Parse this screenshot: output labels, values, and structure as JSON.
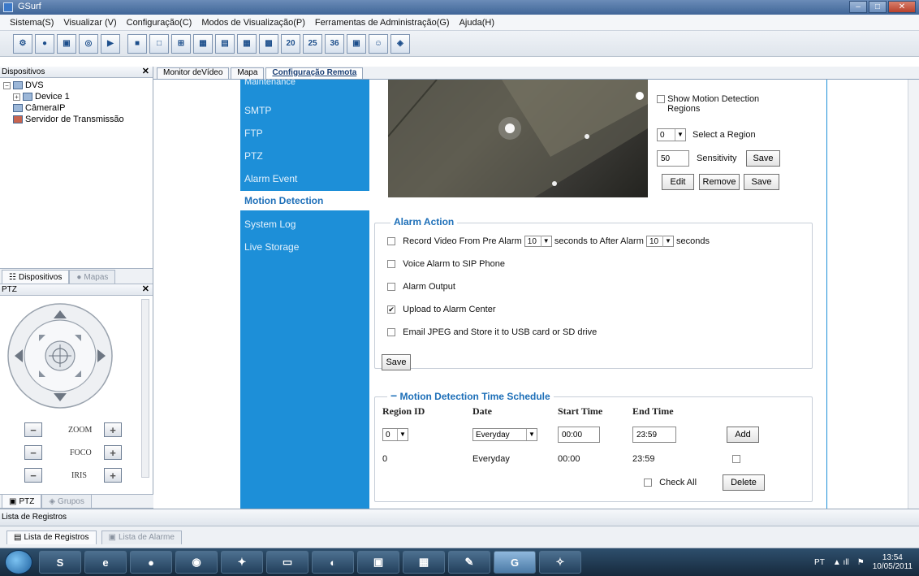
{
  "window": {
    "title": "GSurf"
  },
  "menu": [
    "Sistema(S)",
    "Visualizar (V)",
    "Configuração(C)",
    "Modos de Visualização(P)",
    "Ferramentas de Administração(G)",
    "Ajuda(H)"
  ],
  "toolbar": {
    "grid_labels": [
      "20",
      "25",
      "36"
    ]
  },
  "devices": {
    "header": "Dispositivos",
    "tree": [
      "DVS",
      "Device 1",
      "CâmeraIP",
      "Servidor de Transmissão"
    ],
    "tabs": [
      "Dispositivos",
      "Mapas"
    ]
  },
  "ptz": {
    "header": "PTZ",
    "zoom": "ZOOM",
    "focus": "FOCO",
    "iris": "IRIS",
    "minus": "−",
    "plus": "+",
    "tabs": [
      "PTZ",
      "Grupos"
    ]
  },
  "main_tabs": [
    "Monitor deVídeo",
    "Mapa",
    "Configuração Remota"
  ],
  "nav": [
    "Maintenance",
    "SMTP",
    "FTP",
    "PTZ",
    "Alarm Event",
    "Motion Detection",
    "System Log",
    "Live Storage"
  ],
  "motion_panel": {
    "show_regions": "Show Motion Detection Regions",
    "region_value": "0",
    "select_region": "Select a Region",
    "sensitivity_value": "50",
    "sensitivity_label": "Sensitivity",
    "save": "Save",
    "edit": "Edit",
    "remove": "Remove"
  },
  "alarm_action": {
    "title": "Alarm Action",
    "record_prefix": "Record Video From Pre Alarm",
    "pre_value": "10",
    "mid": "seconds  to After Alarm",
    "after_value": "10",
    "suffix": "seconds",
    "voice": "Voice Alarm to SIP Phone",
    "output": "Alarm Output",
    "upload": "Upload to Alarm Center",
    "email": "Email JPEG and Store it to USB card or SD drive",
    "save": "Save"
  },
  "schedule": {
    "title": "Motion Detection Time Schedule",
    "collapse": "−",
    "headers": [
      "Region ID",
      "Date",
      "Start Time",
      "End Time"
    ],
    "new_row": {
      "region": "0",
      "date": "Everyday",
      "start": "00:00",
      "end": "23:59",
      "add": "Add"
    },
    "rows": [
      {
        "region": "0",
        "date": "Everyday",
        "start": "00:00",
        "end": "23:59"
      }
    ],
    "check_all": "Check All",
    "delete": "Delete"
  },
  "records": {
    "header": "Lista de Registros",
    "tabs": [
      "Lista de Registros",
      "Lista de Alarme"
    ]
  },
  "taskbar": {
    "lang": "PT",
    "time": "13:54",
    "date": "10/05/2011"
  },
  "checks": {
    "upload": "✔"
  }
}
